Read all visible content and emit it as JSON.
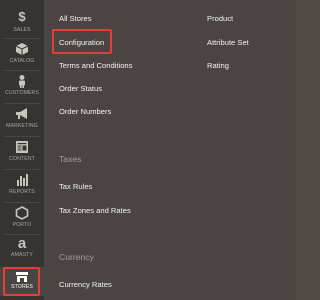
{
  "sidebar": {
    "items": [
      {
        "label": "SALES",
        "icon": "dollar-icon",
        "glyph": "$"
      },
      {
        "label": "CATALOG",
        "icon": "cube-icon"
      },
      {
        "label": "CUSTOMERS",
        "icon": "person-icon"
      },
      {
        "label": "MARKETING",
        "icon": "megaphone-icon"
      },
      {
        "label": "CONTENT",
        "icon": "layout-icon"
      },
      {
        "label": "REPORTS",
        "icon": "bar-chart-icon"
      },
      {
        "label": "PORTO",
        "icon": "hexagon-icon"
      },
      {
        "label": "AMASTY",
        "icon": "amasty-logo-icon",
        "glyph": "a"
      },
      {
        "label": "STORES",
        "icon": "store-icon",
        "active": true
      }
    ]
  },
  "submenu": {
    "column1": {
      "settings": [
        "All Stores",
        "Configuration",
        "Terms and Conditions",
        "Order Status",
        "Order Numbers"
      ],
      "taxes_title": "Taxes",
      "taxes": [
        "Tax Rules",
        "Tax Zones and Rates"
      ],
      "currency_title": "Currency",
      "currency": [
        "Currency Rates"
      ]
    },
    "column2": {
      "attributes": [
        "Product",
        "Attribute Set",
        "Rating"
      ]
    },
    "highlighted": "Configuration"
  },
  "colors": {
    "sidebar_bg": "#373330",
    "panel_bg": "#4a4542",
    "highlight": "#e0403b",
    "link_text": "#f7f3eb",
    "section_title": "#a79d95"
  }
}
